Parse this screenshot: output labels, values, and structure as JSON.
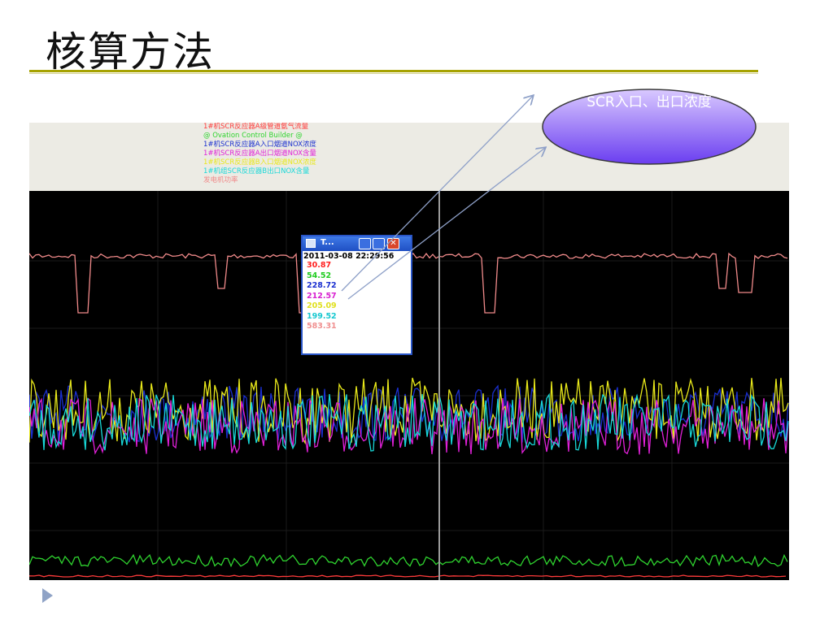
{
  "slide": {
    "title": "核算方法"
  },
  "legend": {
    "lines": [
      {
        "text": "1#机SCR反应器A级管道氨气流量",
        "color": "#ff3b3b"
      },
      {
        "text": "@ Ovation Control Builder @",
        "color": "#2fd42f"
      },
      {
        "text": "1#机SCR反应器A入口烟道NOX浓度",
        "color": "#1a2fd0"
      },
      {
        "text": "1#机SCR反应器A出口烟道NOX含量",
        "color": "#e020d8"
      },
      {
        "text": "1#机SCR反应器B入口烟道NOX浓度",
        "color": "#e8e81a"
      },
      {
        "text": "1#机组SCR反应器B出口NOX含量",
        "color": "#18d8d8"
      },
      {
        "text": "发电机功率",
        "color": "#f08a8a"
      }
    ]
  },
  "popup": {
    "title": "T...",
    "timestamp": "2011-03-08 22:29:56",
    "values": [
      {
        "text": "30.87",
        "color": "#ff2020"
      },
      {
        "text": "54.52",
        "color": "#22cc22"
      },
      {
        "text": "228.72",
        "color": "#1a2fd0"
      },
      {
        "text": "212.57",
        "color": "#d820d0"
      },
      {
        "text": "205.09",
        "color": "#e0e020"
      },
      {
        "text": "199.52",
        "color": "#18c8d0"
      },
      {
        "text": "583.31",
        "color": "#f09090"
      }
    ]
  },
  "callout": {
    "text": "SCR入口、出口浓度",
    "fill_top": "#d9c9ff",
    "fill_bottom": "#6a3df0"
  },
  "colors": {
    "title_rule": "#a6a200",
    "chart_bg": "#000000",
    "legend_bg": "#ecebe4"
  }
}
